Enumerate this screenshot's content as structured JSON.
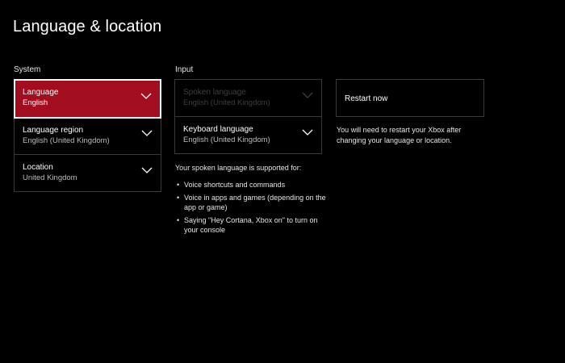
{
  "page": {
    "title": "Language & location"
  },
  "system": {
    "header": "System",
    "items": [
      {
        "label": "Language",
        "value": "English",
        "focused": true
      },
      {
        "label": "Language region",
        "value": "English (United Kingdom)"
      },
      {
        "label": "Location",
        "value": "United Kingdom"
      }
    ]
  },
  "input": {
    "header": "Input",
    "items": [
      {
        "label": "Spoken language",
        "value": "English (United Kingdom)",
        "disabled": true
      },
      {
        "label": "Keyboard language",
        "value": "English (United Kingdom)"
      }
    ],
    "support_text": "Your spoken language is supported for:",
    "support_list": [
      "Voice shortcuts and commands",
      "Voice in apps and games (depending on the app or game)",
      "Saying \"Hey Cortana, Xbox on\" to turn on your console"
    ]
  },
  "restart": {
    "button_label": "Restart now",
    "note": "You will need to restart your Xbox after changing your language or location."
  },
  "colors": {
    "background": "#000000",
    "accent": "#a30d20",
    "border": "#3a3a3a",
    "disabled_text": "#3f3f3f"
  },
  "icons": {
    "dropdown": "chevron-down-icon",
    "bullet": "•"
  }
}
